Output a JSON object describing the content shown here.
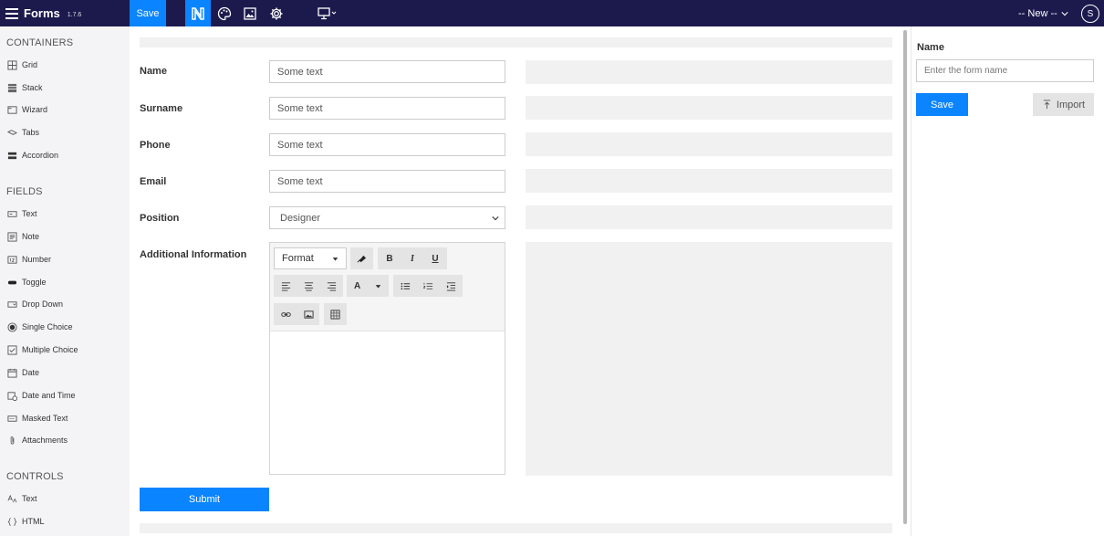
{
  "app": {
    "name": "Forms",
    "version": "1.7.6",
    "save_label": "Save",
    "new_label": "-- New --",
    "avatar_initial": "S"
  },
  "sidebar": {
    "containers_title": "CONTAINERS",
    "containers": [
      {
        "label": "Grid",
        "icon": "grid-icon"
      },
      {
        "label": "Stack",
        "icon": "stack-icon"
      },
      {
        "label": "Wizard",
        "icon": "wizard-icon"
      },
      {
        "label": "Tabs",
        "icon": "tabs-icon"
      },
      {
        "label": "Accordion",
        "icon": "accordion-icon"
      }
    ],
    "fields_title": "FIELDS",
    "fields": [
      {
        "label": "Text",
        "icon": "text-field-icon"
      },
      {
        "label": "Note",
        "icon": "note-icon"
      },
      {
        "label": "Number",
        "icon": "number-icon"
      },
      {
        "label": "Toggle",
        "icon": "toggle-icon"
      },
      {
        "label": "Drop Down",
        "icon": "dropdown-icon"
      },
      {
        "label": "Single Choice",
        "icon": "radio-icon"
      },
      {
        "label": "Multiple Choice",
        "icon": "checkbox-icon"
      },
      {
        "label": "Date",
        "icon": "calendar-icon"
      },
      {
        "label": "Date and Time",
        "icon": "datetime-icon"
      },
      {
        "label": "Masked Text",
        "icon": "masked-text-icon"
      },
      {
        "label": "Attachments",
        "icon": "paperclip-icon"
      }
    ],
    "controls_title": "CONTROLS",
    "controls": [
      {
        "label": "Text",
        "icon": "text-control-icon"
      },
      {
        "label": "HTML",
        "icon": "code-braces-icon"
      }
    ]
  },
  "form": {
    "fields": [
      {
        "label": "Name",
        "value": "Some text"
      },
      {
        "label": "Surname",
        "value": "Some text"
      },
      {
        "label": "Phone",
        "value": "Some text"
      },
      {
        "label": "Email",
        "value": "Some text"
      }
    ],
    "position_label": "Position",
    "position_value": "Designer",
    "additional_label": "Additional Information",
    "editor": {
      "format_label": "Format",
      "bold": "B",
      "italic": "I",
      "underline": "U",
      "font_color": "A"
    },
    "submit_label": "Submit"
  },
  "panel": {
    "name_label": "Name",
    "name_placeholder": "Enter the form name",
    "save_label": "Save",
    "import_label": "Import"
  },
  "colors": {
    "topbar": "#1c1a4d",
    "accent": "#0a84ff"
  }
}
